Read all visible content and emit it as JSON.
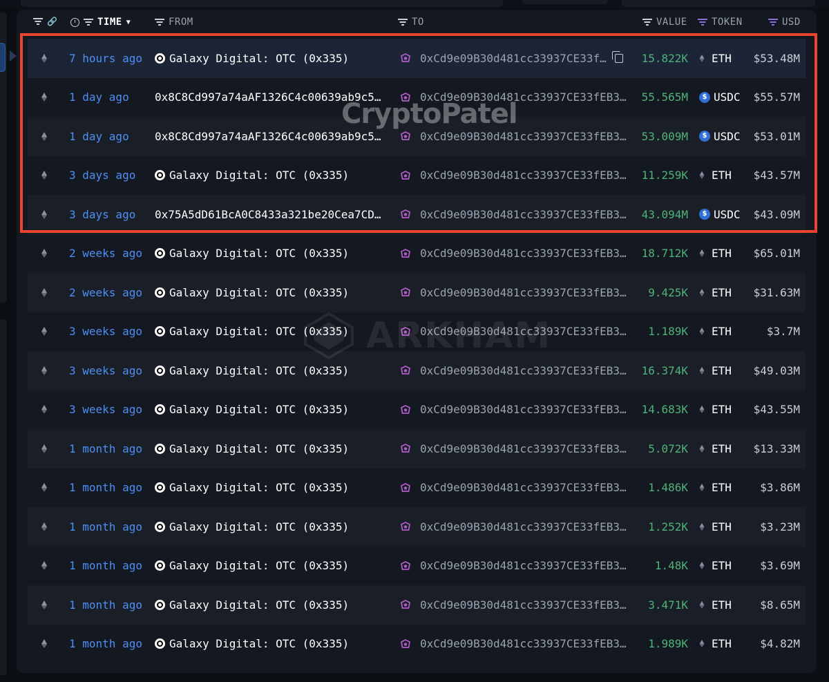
{
  "header": {
    "time_label": "TIME",
    "from_label": "FROM",
    "to_label": "TO",
    "value_label": "VALUE",
    "token_label": "TOKEN",
    "usd_label": "USD"
  },
  "watermark": {
    "text": "CryptoPatel",
    "brand": "ARKHAM"
  },
  "colors": {
    "highlight_border": "#e8442e",
    "time_link": "#4d8ff5",
    "value_green": "#4fb37a",
    "to_icon_purple": "#b25cc9",
    "usdc_blue": "#2f6fd6"
  },
  "icons": {
    "chain": "eth-icon",
    "from_entity": "galaxy-digital-logo",
    "to_entity": "entity-shield-icon",
    "copy": "copy-icon",
    "token_eth": "eth-icon",
    "token_usdc": "usdc-logo"
  },
  "transfers": [
    {
      "time": "7 hours ago",
      "from": "Galaxy Digital: OTC (0x335)",
      "from_entity": true,
      "to": "0xCd9e09B30d481cc33937CE33f…",
      "value": "15.822K",
      "token": "ETH",
      "usd": "$53.48M",
      "selected": true,
      "highlighted": true
    },
    {
      "time": "1 day ago",
      "from": "0x8C8Cd997a74aAF1326C4c00639ab9c5…",
      "from_entity": false,
      "to": "0xCd9e09B30d481cc33937CE33fEB3…",
      "value": "55.565M",
      "token": "USDC",
      "usd": "$55.57M",
      "highlighted": true
    },
    {
      "time": "1 day ago",
      "from": "0x8C8Cd997a74aAF1326C4c00639ab9c5…",
      "from_entity": false,
      "to": "0xCd9e09B30d481cc33937CE33fEB3…",
      "value": "53.009M",
      "token": "USDC",
      "usd": "$53.01M",
      "highlighted": true
    },
    {
      "time": "3 days ago",
      "from": "Galaxy Digital: OTC (0x335)",
      "from_entity": true,
      "to": "0xCd9e09B30d481cc33937CE33fEB3…",
      "value": "11.259K",
      "token": "ETH",
      "usd": "$43.57M",
      "highlighted": true
    },
    {
      "time": "3 days ago",
      "from": "0x75A5dD61BcA0C8433a321be20Cea7CD…",
      "from_entity": false,
      "to": "0xCd9e09B30d481cc33937CE33fEB3…",
      "value": "43.094M",
      "token": "USDC",
      "usd": "$43.09M",
      "highlighted": true
    },
    {
      "time": "2 weeks ago",
      "from": "Galaxy Digital: OTC (0x335)",
      "from_entity": true,
      "to": "0xCd9e09B30d481cc33937CE33fEB3…",
      "value": "18.712K",
      "token": "ETH",
      "usd": "$65.01M"
    },
    {
      "time": "2 weeks ago",
      "from": "Galaxy Digital: OTC (0x335)",
      "from_entity": true,
      "to": "0xCd9e09B30d481cc33937CE33fEB3…",
      "value": "9.425K",
      "token": "ETH",
      "usd": "$31.63M"
    },
    {
      "time": "3 weeks ago",
      "from": "Galaxy Digital: OTC (0x335)",
      "from_entity": true,
      "to": "0xCd9e09B30d481cc33937CE33fEB3…",
      "value": "1.189K",
      "token": "ETH",
      "usd": "$3.7M"
    },
    {
      "time": "3 weeks ago",
      "from": "Galaxy Digital: OTC (0x335)",
      "from_entity": true,
      "to": "0xCd9e09B30d481cc33937CE33fEB3…",
      "value": "16.374K",
      "token": "ETH",
      "usd": "$49.03M"
    },
    {
      "time": "3 weeks ago",
      "from": "Galaxy Digital: OTC (0x335)",
      "from_entity": true,
      "to": "0xCd9e09B30d481cc33937CE33fEB3…",
      "value": "14.683K",
      "token": "ETH",
      "usd": "$43.55M"
    },
    {
      "time": "1 month ago",
      "from": "Galaxy Digital: OTC (0x335)",
      "from_entity": true,
      "to": "0xCd9e09B30d481cc33937CE33fEB3…",
      "value": "5.072K",
      "token": "ETH",
      "usd": "$13.33M"
    },
    {
      "time": "1 month ago",
      "from": "Galaxy Digital: OTC (0x335)",
      "from_entity": true,
      "to": "0xCd9e09B30d481cc33937CE33fEB3…",
      "value": "1.486K",
      "token": "ETH",
      "usd": "$3.86M"
    },
    {
      "time": "1 month ago",
      "from": "Galaxy Digital: OTC (0x335)",
      "from_entity": true,
      "to": "0xCd9e09B30d481cc33937CE33fEB3…",
      "value": "1.252K",
      "token": "ETH",
      "usd": "$3.23M"
    },
    {
      "time": "1 month ago",
      "from": "Galaxy Digital: OTC (0x335)",
      "from_entity": true,
      "to": "0xCd9e09B30d481cc33937CE33fEB3…",
      "value": "1.48K",
      "token": "ETH",
      "usd": "$3.69M"
    },
    {
      "time": "1 month ago",
      "from": "Galaxy Digital: OTC (0x335)",
      "from_entity": true,
      "to": "0xCd9e09B30d481cc33937CE33fEB3…",
      "value": "3.471K",
      "token": "ETH",
      "usd": "$8.65M"
    },
    {
      "time": "1 month ago",
      "from": "Galaxy Digital: OTC (0x335)",
      "from_entity": true,
      "to": "0xCd9e09B30d481cc33937CE33fEB3…",
      "value": "1.989K",
      "token": "ETH",
      "usd": "$4.82M"
    }
  ]
}
